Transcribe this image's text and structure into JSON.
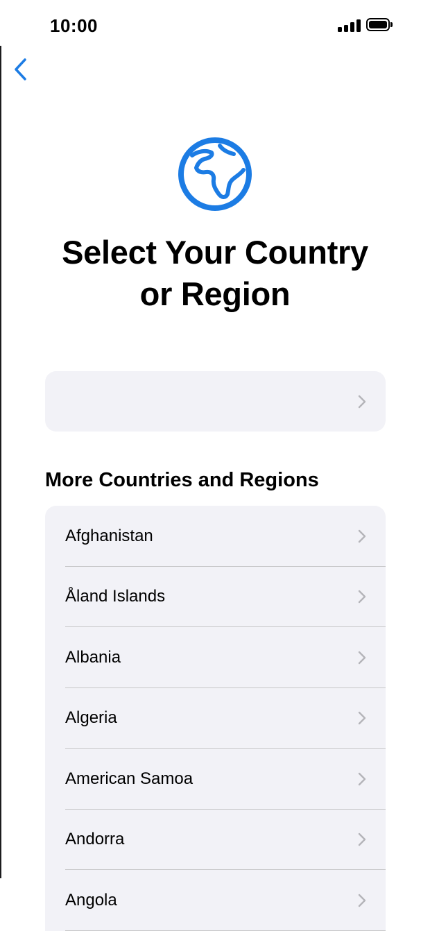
{
  "status_bar": {
    "time": "10:00"
  },
  "colors": {
    "accent": "#1c7ce4",
    "card_background": "#f2f2f7",
    "separator": "#c6c6c8",
    "chevron": "#b4b4b9"
  },
  "icons": {
    "back": "chevron-left-icon",
    "hero": "globe-africa-icon",
    "row_accessory": "chevron-right-icon"
  },
  "header": {
    "title_line1": "Select Your Country",
    "title_line2": "or Region"
  },
  "suggested": {
    "label": ""
  },
  "more_section": {
    "title": "More Countries and Regions",
    "countries": [
      "Afghanistan",
      "Åland Islands",
      "Albania",
      "Algeria",
      "American Samoa",
      "Andorra",
      "Angola"
    ]
  }
}
